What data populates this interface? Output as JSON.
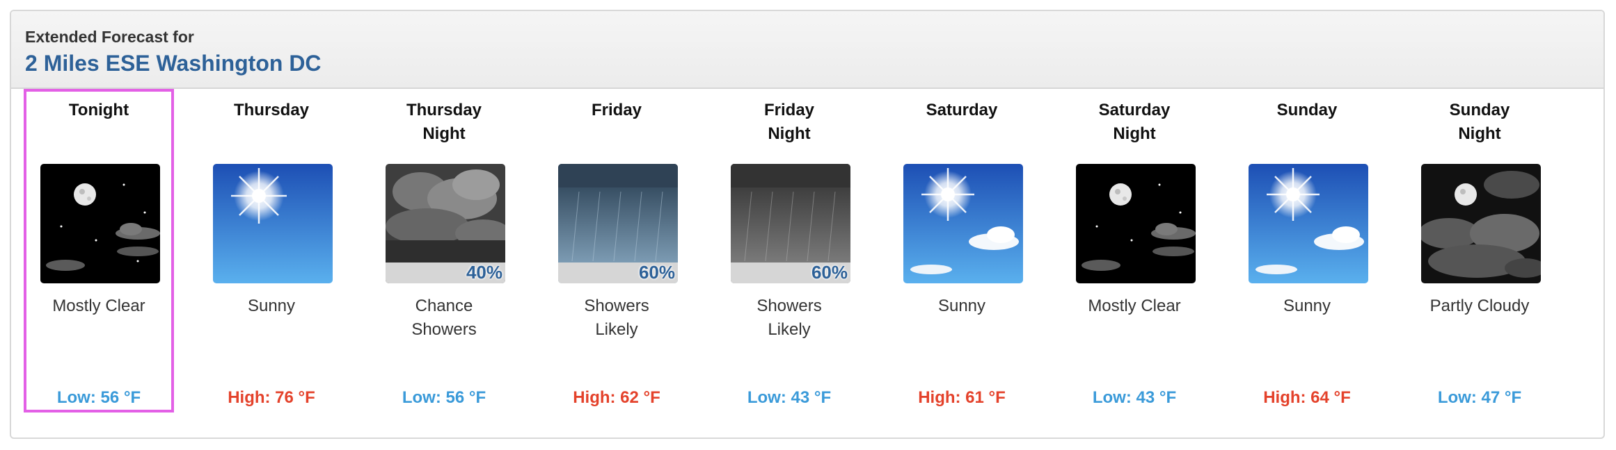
{
  "header": {
    "label": "Extended Forecast for",
    "location": "2 Miles ESE Washington DC"
  },
  "periods": [
    {
      "name": "Tonight",
      "icon": "night-mostly-clear-icon",
      "condition": "Mostly Clear",
      "temp": "Low: 56 °F",
      "temp_type": "low",
      "pop": ""
    },
    {
      "name": "Thursday",
      "icon": "sunny-icon",
      "condition": "Sunny",
      "temp": "High: 76 °F",
      "temp_type": "high",
      "pop": ""
    },
    {
      "name": "Thursday\nNight",
      "icon": "night-chance-showers-icon",
      "condition": "Chance\nShowers",
      "temp": "Low: 56 °F",
      "temp_type": "low",
      "pop": "40%"
    },
    {
      "name": "Friday",
      "icon": "showers-likely-icon",
      "condition": "Showers\nLikely",
      "temp": "High: 62 °F",
      "temp_type": "high",
      "pop": "60%"
    },
    {
      "name": "Friday\nNight",
      "icon": "night-showers-likely-icon",
      "condition": "Showers\nLikely",
      "temp": "Low: 43 °F",
      "temp_type": "low",
      "pop": "60%"
    },
    {
      "name": "Saturday",
      "icon": "sunny-clouds-icon",
      "condition": "Sunny",
      "temp": "High: 61 °F",
      "temp_type": "high",
      "pop": ""
    },
    {
      "name": "Saturday\nNight",
      "icon": "night-mostly-clear-icon",
      "condition": "Mostly Clear",
      "temp": "Low: 43 °F",
      "temp_type": "low",
      "pop": ""
    },
    {
      "name": "Sunday",
      "icon": "sunny-clouds-icon",
      "condition": "Sunny",
      "temp": "High: 64 °F",
      "temp_type": "high",
      "pop": ""
    },
    {
      "name": "Sunday\nNight",
      "icon": "night-partly-cloudy-icon",
      "condition": "Partly Cloudy",
      "temp": "Low: 47 °F",
      "temp_type": "low",
      "pop": ""
    }
  ],
  "colors": {
    "low_temp": "#3a9ad9",
    "high_temp": "#e4422b",
    "location": "#2d6198",
    "selected_border": "#e360e6"
  }
}
